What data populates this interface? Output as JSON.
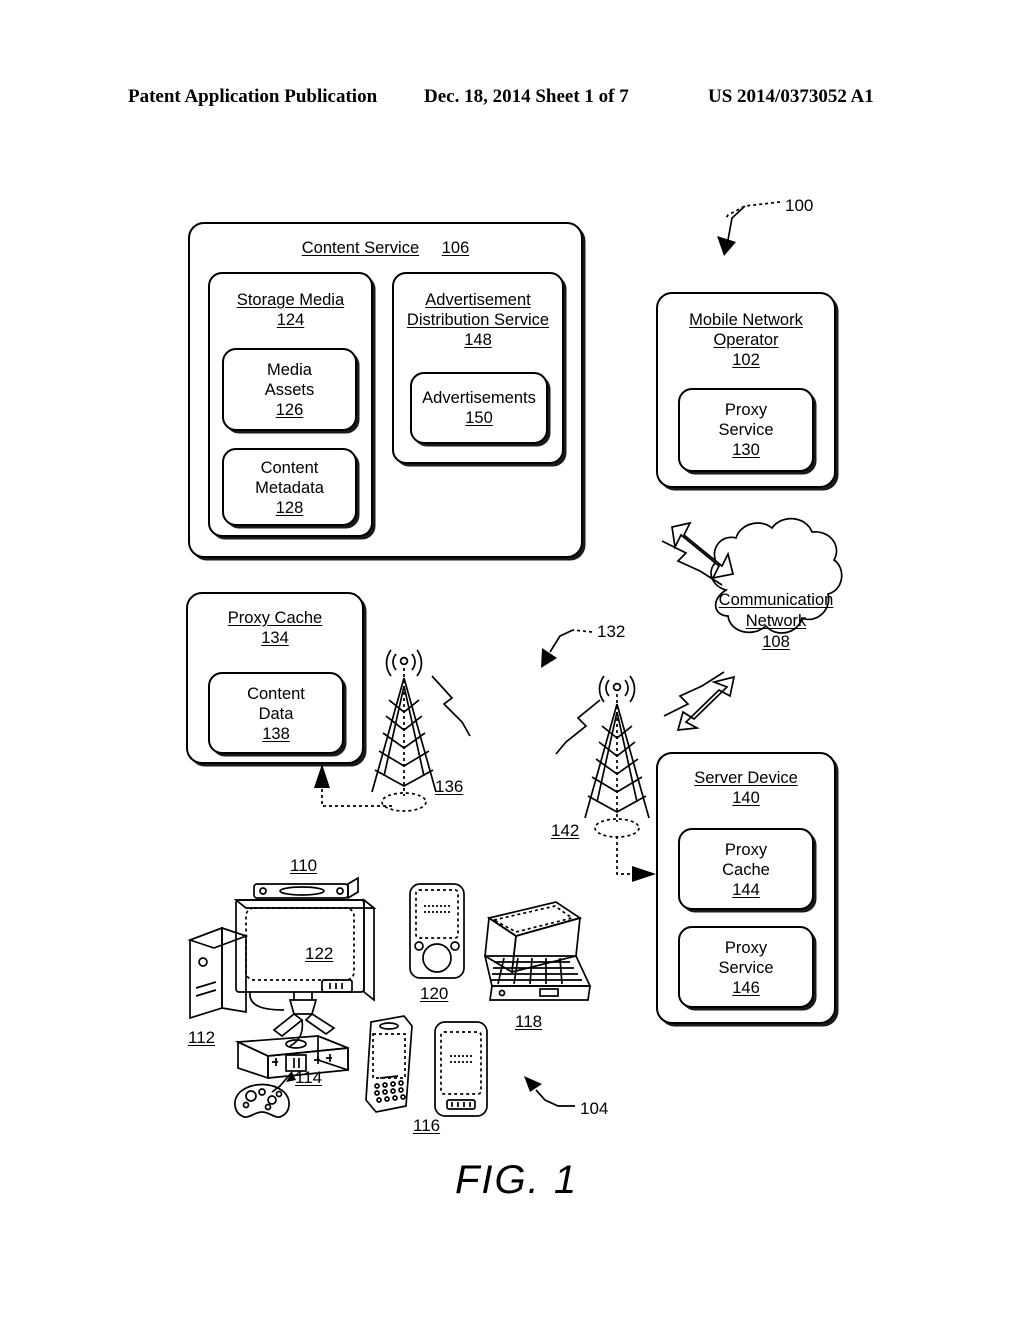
{
  "header": {
    "publication": "Patent Application Publication",
    "date_sheet": "Dec. 18, 2014  Sheet 1 of 7",
    "patent_number": "US 2014/0373052 A1"
  },
  "figure": {
    "caption": "FIG. 1",
    "system_numeral": "100",
    "client_devices_numeral": "104",
    "wireless_link_numeral": "132"
  },
  "boxes": {
    "content_service": {
      "title": "Content Service",
      "num": "106"
    },
    "storage_media": {
      "title": "Storage Media",
      "num": "124"
    },
    "media_assets": {
      "title": "Media\nAssets",
      "line1": "Media",
      "line2": "Assets",
      "num": "126"
    },
    "content_metadata": {
      "line1": "Content",
      "line2": "Metadata",
      "num": "128"
    },
    "ad_distribution": {
      "line1": "Advertisement",
      "line2": "Distribution Service",
      "num": "148"
    },
    "advertisements": {
      "title": "Advertisements",
      "num": "150"
    },
    "mobile_network_op": {
      "line1": "Mobile Network",
      "line2": "Operator",
      "num": "102"
    },
    "proxy_service_mno": {
      "line1": "Proxy",
      "line2": "Service",
      "num": "130"
    },
    "communication_network": {
      "line1": "Communication",
      "line2": "Network",
      "num": "108"
    },
    "proxy_cache_local": {
      "title": "Proxy Cache",
      "num": "134"
    },
    "content_data": {
      "line1": "Content",
      "line2": "Data",
      "num": "138"
    },
    "server_device": {
      "title": "Server Device",
      "num": "140"
    },
    "proxy_cache_server": {
      "line1": "Proxy",
      "line2": "Cache",
      "num": "144"
    },
    "proxy_service_server": {
      "line1": "Proxy",
      "line2": "Service",
      "num": "146"
    }
  },
  "towers": {
    "tower_left": {
      "num": "136"
    },
    "tower_right": {
      "num": "142"
    }
  },
  "devices": {
    "group_numeral": "110",
    "desktop_tower": "112",
    "monitor": "122",
    "game_console": "114",
    "media_player": "120",
    "smartphone_pda": "116",
    "laptop": "118"
  },
  "colors": {
    "ink": "#000000",
    "paper": "#ffffff"
  }
}
